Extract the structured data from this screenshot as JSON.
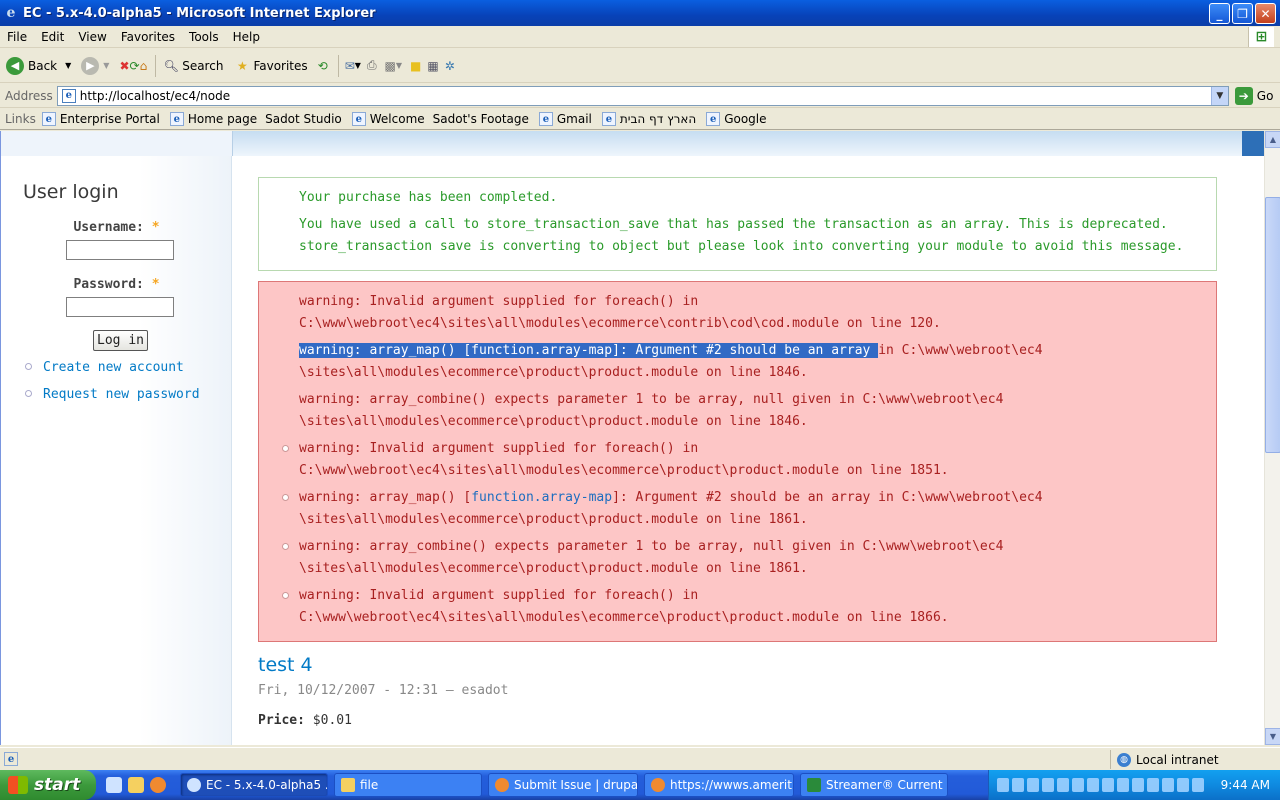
{
  "window": {
    "title": "EC - 5.x-4.0-alpha5 - Microsoft Internet Explorer"
  },
  "menu": [
    "File",
    "Edit",
    "View",
    "Favorites",
    "Tools",
    "Help"
  ],
  "toolbar": {
    "back": "Back",
    "search": "Search",
    "favorites": "Favorites"
  },
  "address": {
    "label": "Address",
    "url": "http://localhost/ec4/node",
    "go": "Go"
  },
  "links": {
    "label": "Links",
    "items": [
      "Enterprise Portal",
      "Home page",
      "Sadot Studio",
      "Welcome",
      "Sadot's Footage",
      "Gmail",
      "הארץ דף הבית",
      "Google"
    ]
  },
  "sidebar": {
    "title": "User login",
    "username_label": "Username:",
    "password_label": "Password:",
    "required_mark": "*",
    "login_button": "Log in",
    "links": [
      "Create new account",
      "Request new password"
    ]
  },
  "status_messages": [
    "Your purchase has been completed.",
    "You have used a call to store_transaction_save that has passed the transaction as an array. This is deprecated. store_transaction save is converting to object but please look into converting your module to avoid this message."
  ],
  "errors": {
    "e1": "warning: Invalid argument supplied for foreach() in C:\\www\\webroot\\ec4\\sites\\all\\modules\\ecommerce\\contrib\\cod\\cod.module on line 120.",
    "e2_selected": "warning: array_map() [function.array-map]: Argument #2 should be an array ",
    "e2_rest": "in C:\\www\\webroot\\ec4",
    "e2_line2": "\\sites\\all\\modules\\ecommerce\\product\\product.module on line 1846.",
    "e3": "warning: array_combine() expects parameter 1 to be array, null given in C:\\www\\webroot\\ec4\n\\sites\\all\\modules\\ecommerce\\product\\product.module on line 1846.",
    "e4": "warning: Invalid argument supplied for foreach() in C:\\www\\webroot\\ec4\\sites\\all\\modules\\ecommerce\\product\\product.module on line 1851.",
    "e5_pre": "warning: array_map() [",
    "e5_link": "function.array-map",
    "e5_post": "]: Argument #2 should be an array in C:\\www\\webroot\\ec4",
    "e5_line2": "\\sites\\all\\modules\\ecommerce\\product\\product.module on line 1861.",
    "e6": "warning: array_combine() expects parameter 1 to be array, null given in C:\\www\\webroot\\ec4\n\\sites\\all\\modules\\ecommerce\\product\\product.module on line 1861.",
    "e7": "warning: Invalid argument supplied for foreach() in C:\\www\\webroot\\ec4\\sites\\all\\modules\\ecommerce\\product\\product.module on line 1866."
  },
  "node": {
    "title": "test 4",
    "meta": "Fri, 10/12/2007 - 12:31 — esadot",
    "price_label": "Price:",
    "price_value": "$0.01"
  },
  "statusbar": {
    "zone": "Local intranet"
  },
  "taskbar": {
    "start": "start",
    "tasks": [
      "EC - 5.x-4.0-alpha5 ...",
      "file",
      "Submit Issue | drupal...",
      "https://wwws.amerit...",
      "Streamer® Current ..."
    ],
    "clock": "9:44 AM"
  },
  "colors": {
    "link": "#027ac6",
    "success_text": "#2a9a2a",
    "error_bg": "#fdc6c6",
    "error_text": "#a82020",
    "selection": "#316ac5"
  }
}
